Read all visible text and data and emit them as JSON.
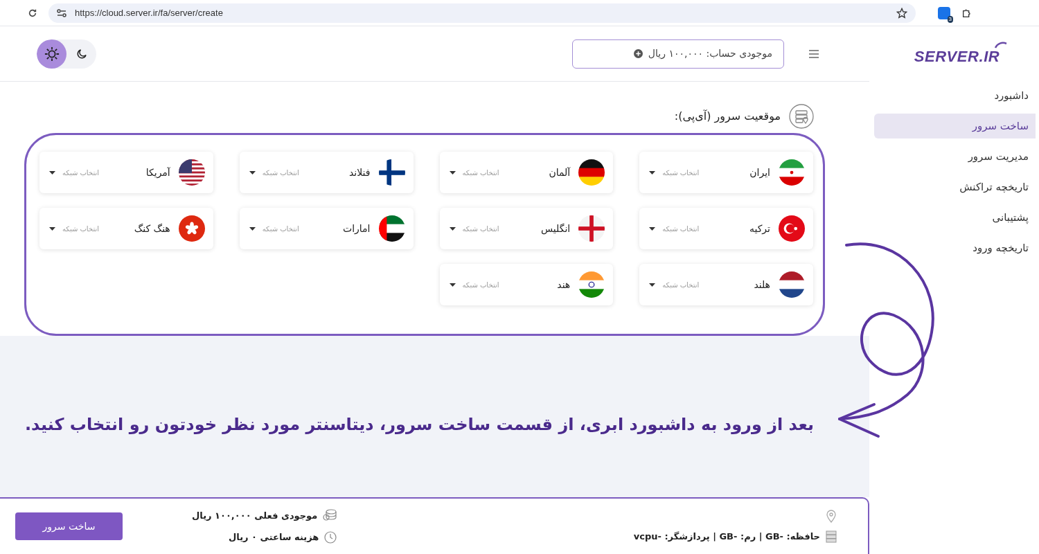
{
  "browser": {
    "url": "https://cloud.server.ir/fa/server/create",
    "extension_badge": "3"
  },
  "logo": "SERVER.IR",
  "header": {
    "balance": "موجودی حساب: ۱۰۰,۰۰۰ ریال",
    "theme_toggle": [
      {
        "kind": "light",
        "selected": true
      },
      {
        "kind": "dark",
        "selected": false
      }
    ]
  },
  "sidebar": {
    "items": [
      {
        "label": "داشبورد",
        "selected": false
      },
      {
        "label": "ساخت سرور",
        "selected": true
      },
      {
        "label": "مدیریت سرور",
        "selected": false
      },
      {
        "label": "تاریخچه تراکنش",
        "selected": false
      },
      {
        "label": "پشتیبانی",
        "selected": false
      },
      {
        "label": "تاریخچه ورود",
        "selected": false
      }
    ]
  },
  "location": {
    "title": "موقعیت سرور (آی‌پی):",
    "countries": [
      {
        "name": "ایران",
        "kind": "ir",
        "placeholder": "انتخاب شبکه"
      },
      {
        "name": "آلمان",
        "kind": "de",
        "placeholder": "انتخاب شبکه"
      },
      {
        "name": "فنلاند",
        "kind": "fi",
        "placeholder": "انتخاب شبکه"
      },
      {
        "name": "آمریکا",
        "kind": "us",
        "placeholder": "انتخاب شبکه"
      },
      {
        "name": "ترکیه",
        "kind": "tr",
        "placeholder": "انتخاب شبکه"
      },
      {
        "name": "انگلیس",
        "kind": "en",
        "placeholder": "انتخاب شبکه"
      },
      {
        "name": "امارات",
        "kind": "ae",
        "placeholder": "انتخاب شبکه"
      },
      {
        "name": "هنگ کنگ",
        "kind": "hk",
        "placeholder": "انتخاب شبکه"
      },
      {
        "name": "هلند",
        "kind": "nl",
        "placeholder": "انتخاب شبکه"
      },
      {
        "name": "هند",
        "kind": "in",
        "placeholder": "انتخاب شبکه"
      }
    ]
  },
  "annotation": {
    "caption": "بعد از ورود به داشبورد ابری، از قسمت ساخت سرور، دیتاسنتر مورد نظر خودتون رو انتخاب کنید."
  },
  "footer": {
    "balance": "موجودی فعلی ۱۰۰,۰۰۰ ریال",
    "hourly_cost": "هزینه ساعتی ۰ ریال",
    "specs": "حافظه: -GB | رم: -GB | پردازشگر: -vcpu",
    "button": "ساخت سرور"
  }
}
